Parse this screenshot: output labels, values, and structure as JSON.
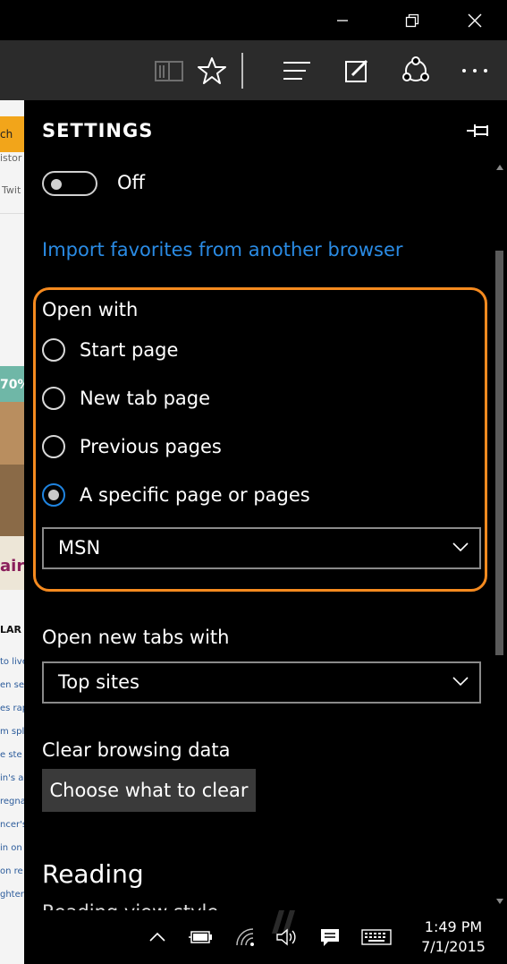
{
  "window": {
    "minimize_icon": "minimize-icon",
    "restore_icon": "restore-icon",
    "close_icon": "close-icon"
  },
  "toolbar": {
    "icons": [
      "reading-view-icon",
      "favorite-star-icon",
      "hub-icon",
      "web-note-icon",
      "share-icon",
      "more-icon"
    ]
  },
  "background_page": {
    "search_text": "ch",
    "history_text": "istor",
    "twitter_text": "Twit",
    "ad_percent": "70%",
    "ad_logo": "air",
    "popular_label": "LAR",
    "links": [
      "to live",
      "en seel",
      "es rap",
      "m spl",
      "e ste",
      "in's a",
      "regna",
      "ncer's",
      "in on",
      "on re",
      "ghter"
    ]
  },
  "settings": {
    "title": "SETTINGS",
    "toggle_label": "Off",
    "import_link": "Import favorites from another browser",
    "open_with": {
      "label": "Open with",
      "options": [
        {
          "label": "Start page",
          "checked": false
        },
        {
          "label": "New tab page",
          "checked": false
        },
        {
          "label": "Previous pages",
          "checked": false
        },
        {
          "label": "A specific page or pages",
          "checked": true
        }
      ],
      "page_select": "MSN"
    },
    "new_tabs": {
      "label": "Open new tabs with",
      "value": "Top sites"
    },
    "clear_data": {
      "label": "Clear browsing data",
      "button": "Choose what to clear"
    },
    "reading": {
      "title": "Reading",
      "partial_text": "Reading view style"
    }
  },
  "taskbar": {
    "time": "1:49 PM",
    "date": "7/1/2015"
  },
  "colors": {
    "accent_blue": "#2a8be4",
    "highlight_orange": "#f58a1f",
    "pane_bg": "#000000",
    "toolbar_bg": "#2b2b2b"
  }
}
